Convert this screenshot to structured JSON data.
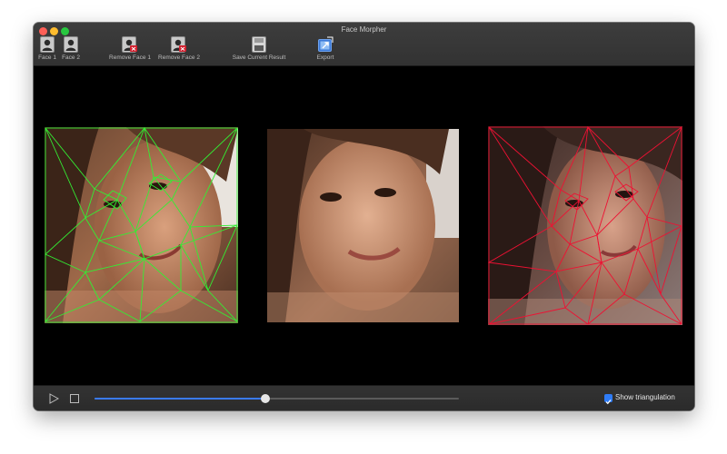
{
  "window": {
    "title": "Face Morpher"
  },
  "toolbar": {
    "items": [
      {
        "label": "Face 1",
        "icon": "portrait-icon"
      },
      {
        "label": "Face 2",
        "icon": "portrait-icon"
      },
      {
        "label": "Remove Face 1",
        "icon": "portrait-remove-icon"
      },
      {
        "label": "Remove Face 2",
        "icon": "portrait-remove-icon"
      },
      {
        "label": "Save Current Result",
        "icon": "save-icon"
      },
      {
        "label": "Export",
        "icon": "export-icon"
      }
    ]
  },
  "panels": {
    "face1": {
      "overlay": "triangulation",
      "overlay_color": "#33ee33"
    },
    "result": {
      "overlay": "none"
    },
    "face2": {
      "overlay": "triangulation",
      "overlay_color": "#ee1133"
    }
  },
  "playback": {
    "play_icon": "play-icon",
    "stop_icon": "stop-icon",
    "progress": 0.47,
    "accent_color": "#3a7bf7"
  },
  "options": {
    "show_triangulation_label": "Show triangulation",
    "show_triangulation_checked": true
  }
}
